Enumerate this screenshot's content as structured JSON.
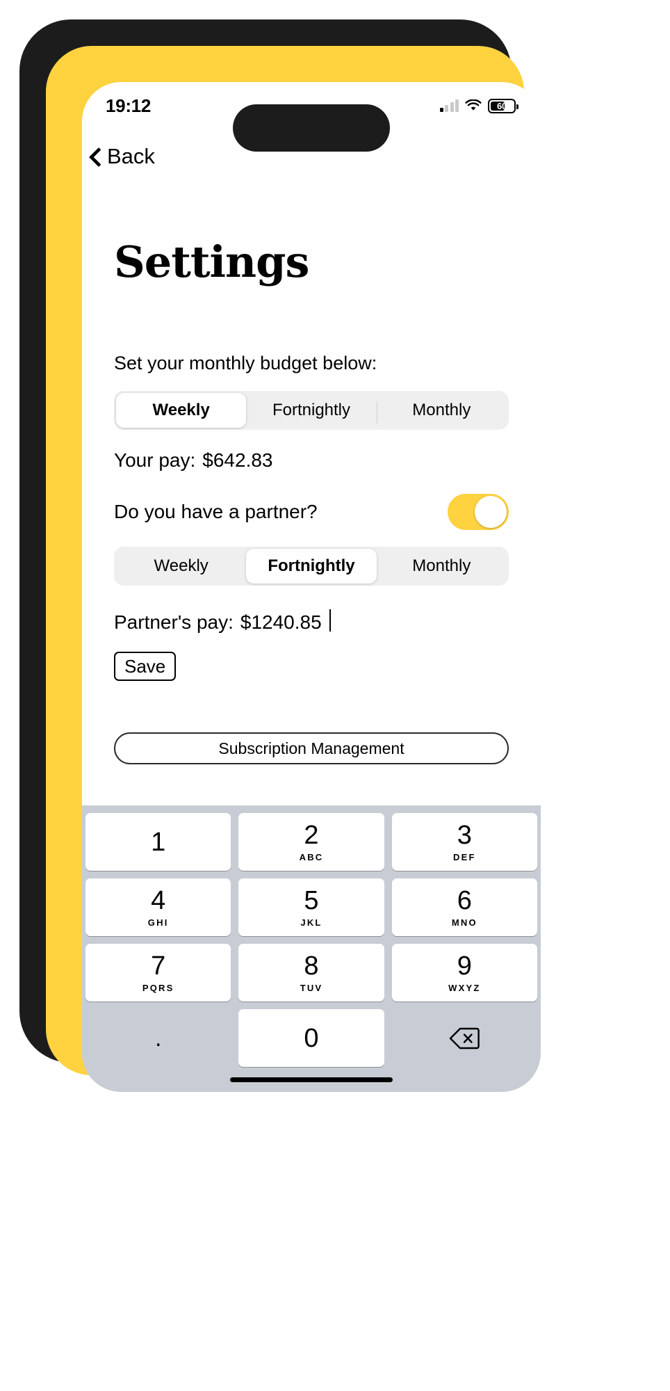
{
  "device": {
    "frame_color": "#FFD23F",
    "bezel_color": "#1C1C1C"
  },
  "status_bar": {
    "time": "19:12",
    "signal_icon": "cellular-signal-icon",
    "wifi_icon": "wifi-icon",
    "battery_icon": "battery-icon",
    "battery_level": "60"
  },
  "nav": {
    "back_label": "Back",
    "back_icon": "chevron-left-icon"
  },
  "page": {
    "title": "Settings",
    "section_label": "Set your monthly budget below:"
  },
  "budget_segment": {
    "options": [
      "Weekly",
      "Fortnightly",
      "Monthly"
    ],
    "selected": "Weekly"
  },
  "your_pay": {
    "label": "Your pay:",
    "value": "$642.83"
  },
  "partner": {
    "question": "Do you have a partner?",
    "toggle_on": true,
    "toggle_color": "#FFD23F"
  },
  "partner_segment": {
    "options": [
      "Weekly",
      "Fortnightly",
      "Monthly"
    ],
    "selected": "Fortnightly"
  },
  "partner_pay": {
    "label": "Partner's pay:",
    "value": "$1240.85"
  },
  "actions": {
    "save_label": "Save",
    "subscription_label": "Subscription Management"
  },
  "keypad": {
    "keys": [
      {
        "num": "1",
        "sub": ""
      },
      {
        "num": "2",
        "sub": "ABC"
      },
      {
        "num": "3",
        "sub": "DEF"
      },
      {
        "num": "4",
        "sub": "GHI"
      },
      {
        "num": "5",
        "sub": "JKL"
      },
      {
        "num": "6",
        "sub": "MNO"
      },
      {
        "num": "7",
        "sub": "PQRS"
      },
      {
        "num": "8",
        "sub": "TUV"
      },
      {
        "num": "9",
        "sub": "WXYZ"
      }
    ],
    "decimal": ".",
    "zero": "0",
    "backspace_icon": "backspace-delete-icon"
  }
}
